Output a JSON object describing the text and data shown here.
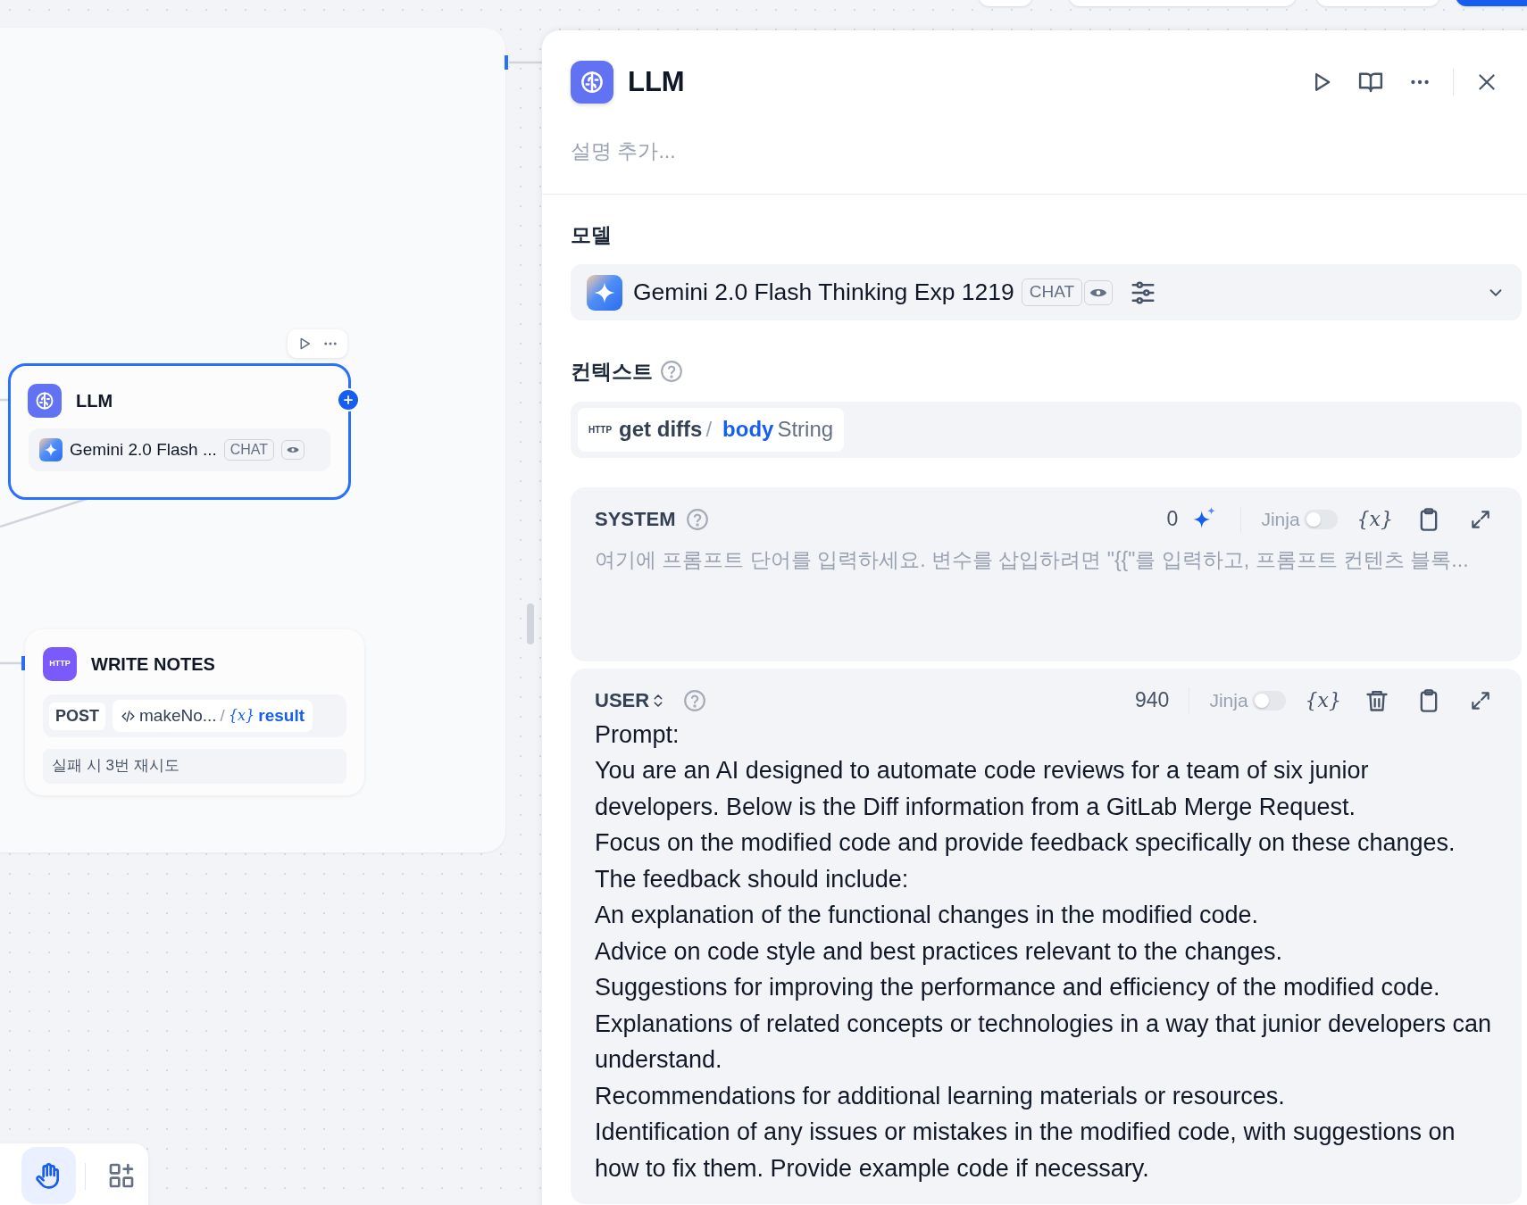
{
  "canvas": {
    "llm_node": {
      "title": "LLM",
      "selected": true,
      "model": "Gemini 2.0 Flash ...",
      "mode": "CHAT"
    },
    "write_notes_node": {
      "title": "WRITE NOTES",
      "icon_label": "HTTP",
      "method": "POST",
      "source": "makeNo...",
      "separator": "/",
      "variable_icon": "{x}",
      "variable": "result",
      "retry": "실패 시 3번 재시도"
    },
    "toolbar": [
      {
        "kind": "hand",
        "selected": true
      },
      {
        "kind": "add",
        "selected": false
      }
    ]
  },
  "panel": {
    "title": "LLM",
    "description_placeholder": "설명 추가...",
    "model_label": "모델",
    "model": {
      "name": "Gemini 2.0 Flash Thinking Exp 1219",
      "mode": "CHAT"
    },
    "context_label": "컨텍스트",
    "context": {
      "source_label": "HTTP",
      "source": "get diffs",
      "separator": "/",
      "variable": "body",
      "type": "String"
    },
    "messages": [
      {
        "kind": "system",
        "role": "SYSTEM",
        "count": "0",
        "jinja": {
          "label": "Jinja",
          "on": false,
          "disabled": true
        },
        "variable_icon": "{x}",
        "placeholder": "여기에 프롬프트 단어를 입력하세요. 변수를 삽입하려면 \"{{\"를 입력하고, 프롬프트 컨텐츠 블록..."
      },
      {
        "kind": "user",
        "role": "USER",
        "count": "940",
        "jinja": {
          "label": "Jinja",
          "on": false,
          "disabled": true
        },
        "variable_icon": "{x}",
        "paragraphs": [
          "Prompt:",
          "You are an AI designed to automate code reviews for a team of six junior developers. Below is the Diff information from a GitLab Merge Request.",
          "Focus on the modified code and provide feedback specifically on these changes.",
          "The feedback should include:",
          "An explanation of the functional changes in the modified code.",
          "Advice on code style and best practices relevant to the changes.",
          "Suggestions for improving the performance and efficiency of the modified code.",
          "Explanations of related concepts or technologies in a way that junior developers can understand.",
          "Recommendations for additional learning materials or resources.",
          "Identification of any issues or mistakes in the modified code, with suggestions on how to fix them. Provide example code if necessary."
        ]
      }
    ]
  }
}
